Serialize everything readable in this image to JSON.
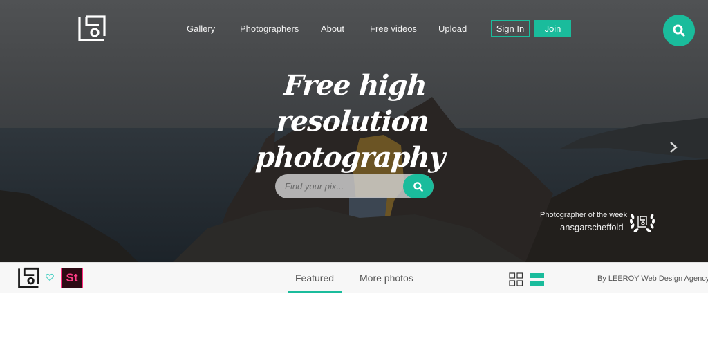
{
  "header": {
    "logo_name": "Picjumbo-style square logo",
    "nav": [
      {
        "label": "Gallery"
      },
      {
        "label": "Photographers"
      },
      {
        "label": "About"
      },
      {
        "label": "Free videos"
      },
      {
        "label": "Upload"
      }
    ],
    "signin_label": "Sign In",
    "join_label": "Join",
    "search_icon": "search-icon"
  },
  "hero": {
    "headline_line1": "Free high resolution",
    "headline_line2": "photography",
    "search": {
      "placeholder": "Find your pix...",
      "value": ""
    },
    "next_icon": "chevron-right-icon",
    "photographer_of_week": {
      "label": "Photographer of the week",
      "name": "ansgarscheffold",
      "badge_icon": "laurel-wreath-icon"
    }
  },
  "subbar": {
    "st_badge": "St",
    "tabs": [
      {
        "label": "Featured",
        "active": true
      },
      {
        "label": "More photos",
        "active": false
      }
    ],
    "view_modes": [
      {
        "icon": "grid-view-icon",
        "active": false
      },
      {
        "icon": "list-view-icon",
        "active": true
      }
    ],
    "credit": "By LEEROY Web Design Agency"
  },
  "colors": {
    "accent": "#1abc9c",
    "st_pink": "#ff3d87",
    "subbar_bg": "#f7f7f7"
  }
}
